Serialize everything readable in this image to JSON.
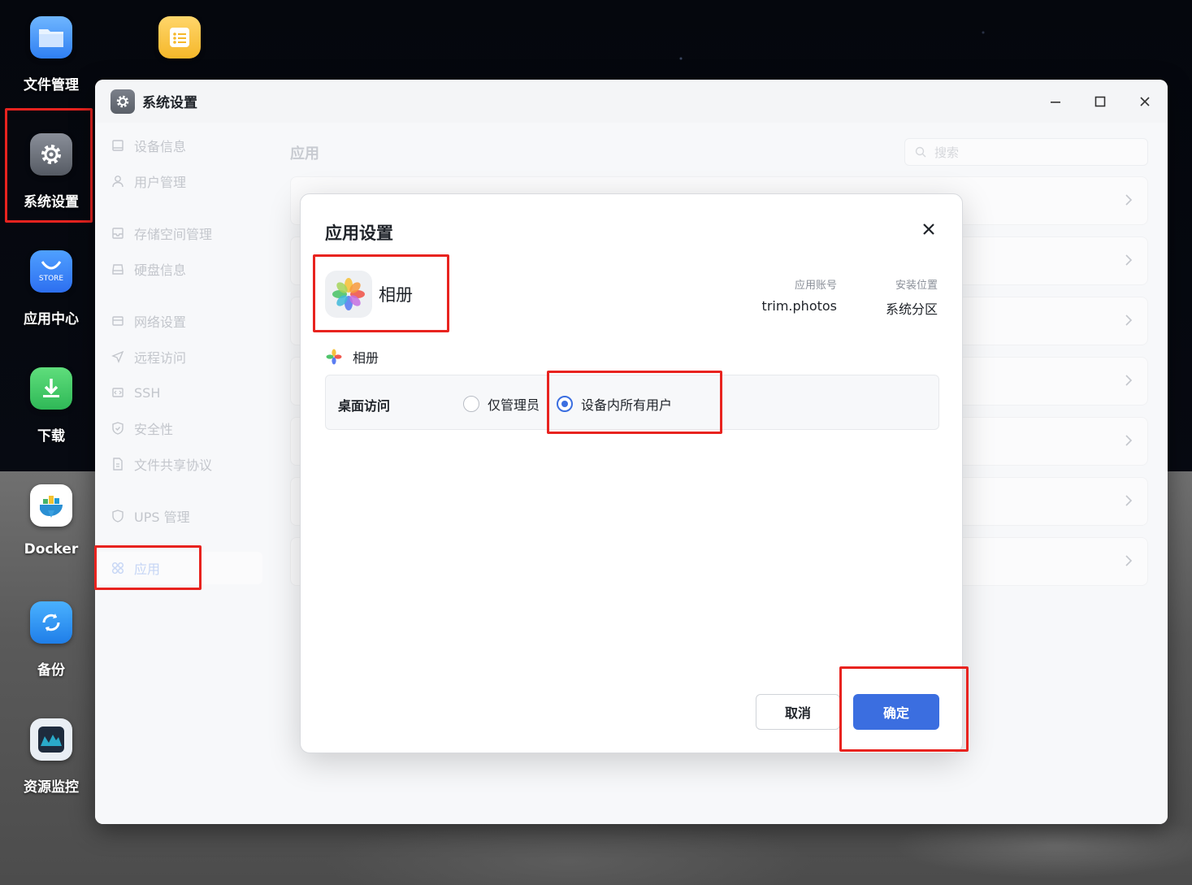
{
  "desktop": {
    "icons": [
      {
        "label": "文件管理"
      },
      {
        "label": ""
      },
      {
        "label": "系统设置"
      },
      {
        "label": "应用中心",
        "badge": "STORE"
      },
      {
        "label": "下载"
      },
      {
        "label": "Docker"
      },
      {
        "label": "备份"
      },
      {
        "label": "资源监控"
      }
    ]
  },
  "window": {
    "title": "系统设置",
    "controls": [
      "minimize-icon",
      "maximize-icon",
      "close-icon"
    ]
  },
  "sidebar": {
    "items": [
      {
        "label": "设备信息",
        "icon": "device-icon"
      },
      {
        "label": "用户管理",
        "icon": "user-icon"
      },
      {
        "label": "存储空间管理",
        "icon": "storage-icon"
      },
      {
        "label": "硬盘信息",
        "icon": "disk-icon"
      },
      {
        "label": "网络设置",
        "icon": "network-icon"
      },
      {
        "label": "远程访问",
        "icon": "remote-icon"
      },
      {
        "label": "SSH",
        "icon": "ssh-icon"
      },
      {
        "label": "安全性",
        "icon": "shield-icon"
      },
      {
        "label": "文件共享协议",
        "icon": "file-share-icon"
      },
      {
        "label": "UPS 管理",
        "icon": "ups-icon"
      },
      {
        "label": "应用",
        "icon": "apps-icon",
        "active": true
      }
    ]
  },
  "content": {
    "heading": "应用",
    "search_placeholder": "搜索"
  },
  "dialog": {
    "title": "应用设置",
    "app_name": "相册",
    "account_label": "应用账号",
    "account_value": "trim.photos",
    "location_label": "安装位置",
    "location_value": "系统分区",
    "section_name": "相册",
    "desktop_access": {
      "label": "桌面访问",
      "options": [
        "仅管理员",
        "设备内所有用户"
      ],
      "selected": "设备内所有用户"
    },
    "cancel_label": "取消",
    "confirm_label": "确定"
  },
  "colors": {
    "accent": "#3b6ee0",
    "highlight": "#e8231f"
  }
}
